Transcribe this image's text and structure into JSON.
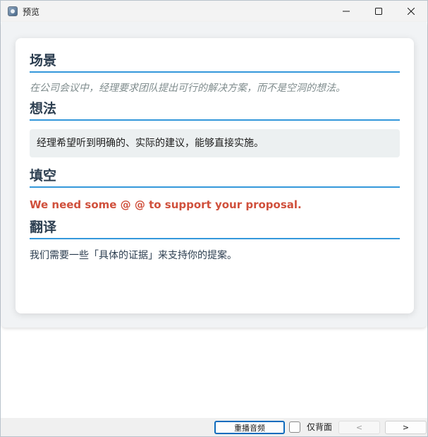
{
  "window": {
    "title": "预览"
  },
  "sections": {
    "scene": {
      "heading": "场景",
      "text": "在公司会议中，经理要求团队提出可行的解决方案，而不是空洞的想法。"
    },
    "idea": {
      "heading": "想法",
      "text": "经理希望听到明确的、实际的建议，能够直接实施。"
    },
    "fill": {
      "heading": "填空",
      "text": "We need some @ @ to support your proposal."
    },
    "translation": {
      "heading": "翻译",
      "text": "我们需要一些「具体的证据」来支持你的提案。"
    }
  },
  "bottom_bar": {
    "replay_label": "重播音频",
    "back_only_label": "仅背面",
    "back_only_checked": false,
    "prev_label": "<",
    "next_label": ">"
  },
  "colors": {
    "heading": "#2c3e50",
    "heading_underline": "#3498db",
    "scene_text": "#7f8c8d",
    "fill_text": "#d0503c",
    "idea_bg": "#ecf0f1",
    "pane_bg": "#f1f3f5"
  },
  "icons": {
    "app": "app-icon",
    "minimize": "minimize-icon",
    "maximize": "maximize-icon",
    "close": "close-icon"
  }
}
